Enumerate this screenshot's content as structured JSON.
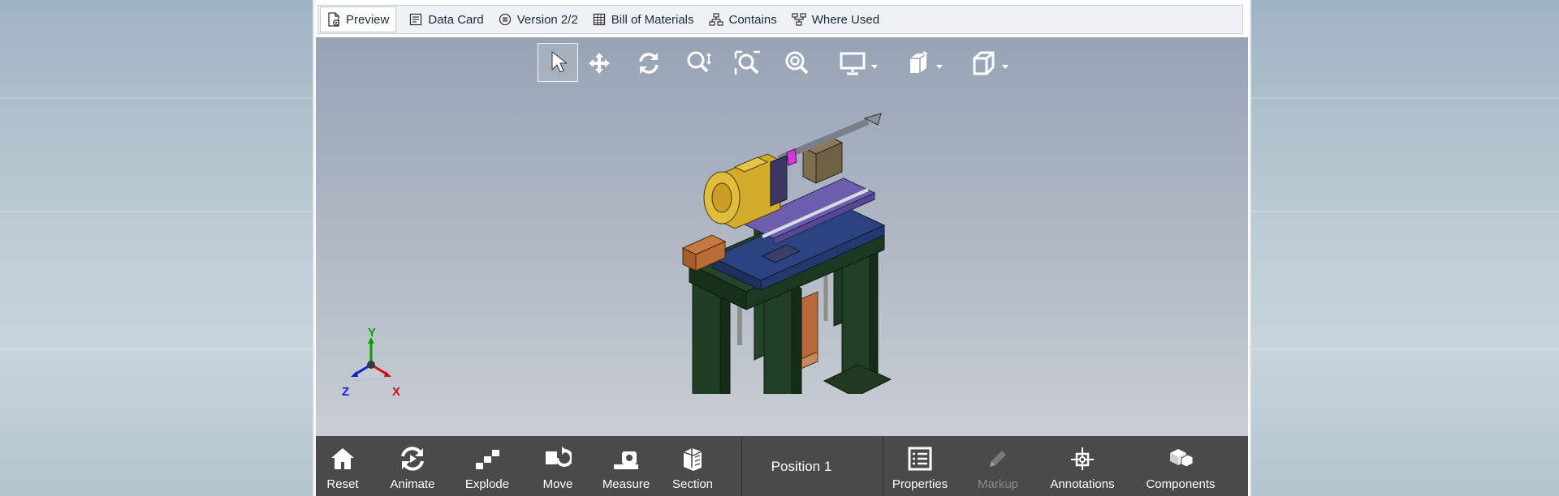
{
  "tabs": [
    {
      "label": "Preview",
      "icon": "preview-icon",
      "active": true
    },
    {
      "label": "Data Card",
      "icon": "data-card-icon"
    },
    {
      "label": "Version 2/2",
      "icon": "version-icon"
    },
    {
      "label": "Bill of Materials",
      "icon": "table-icon"
    },
    {
      "label": "Contains",
      "icon": "hierarchy-icon"
    },
    {
      "label": "Where Used",
      "icon": "where-used-icon"
    }
  ],
  "viewer_tools": [
    {
      "name": "select-tool",
      "icon": "cursor-arrow-icon",
      "selected": true
    },
    {
      "name": "pan-tool",
      "icon": "move-arrows-icon"
    },
    {
      "name": "rotate-tool",
      "icon": "rotate-icon"
    },
    {
      "name": "zoom-tool",
      "icon": "zoom-updown-icon"
    },
    {
      "name": "zoom-area-tool",
      "icon": "zoom-area-icon"
    },
    {
      "name": "zoom-fit-tool",
      "icon": "zoom-fit-icon"
    },
    {
      "name": "display-tool",
      "icon": "monitor-icon",
      "dropdown": true
    },
    {
      "name": "view-orientation-tool",
      "icon": "view-orientation-icon",
      "dropdown": true
    },
    {
      "name": "display-style-tool",
      "icon": "cube-icon",
      "dropdown": true
    }
  ],
  "triad": {
    "x_label": "X",
    "y_label": "Y",
    "z_label": "Z"
  },
  "bottom_toolbar": {
    "left": [
      {
        "label": "Reset",
        "icon": "home-icon"
      },
      {
        "label": "Animate",
        "icon": "animate-icon"
      },
      {
        "label": "Explode",
        "icon": "explode-icon"
      },
      {
        "label": "Move",
        "icon": "move-component-icon"
      },
      {
        "label": "Measure",
        "icon": "measure-icon"
      },
      {
        "label": "Section",
        "icon": "section-icon"
      }
    ],
    "position_label": "Position 1",
    "right": [
      {
        "label": "Properties",
        "icon": "properties-icon"
      },
      {
        "label": "Markup",
        "icon": "pencil-icon",
        "disabled": true
      },
      {
        "label": "Annotations",
        "icon": "annotations-icon"
      },
      {
        "label": "Components",
        "icon": "components-icon"
      }
    ]
  },
  "colors": {
    "frame_green": "#1f3d1f",
    "base_blue": "#2a3f7a",
    "plate_purple": "#6a5aa8",
    "motor_yellow": "#d4ad2a",
    "copper": "#b86a32",
    "bottom_bar": "#4a4a4a"
  }
}
